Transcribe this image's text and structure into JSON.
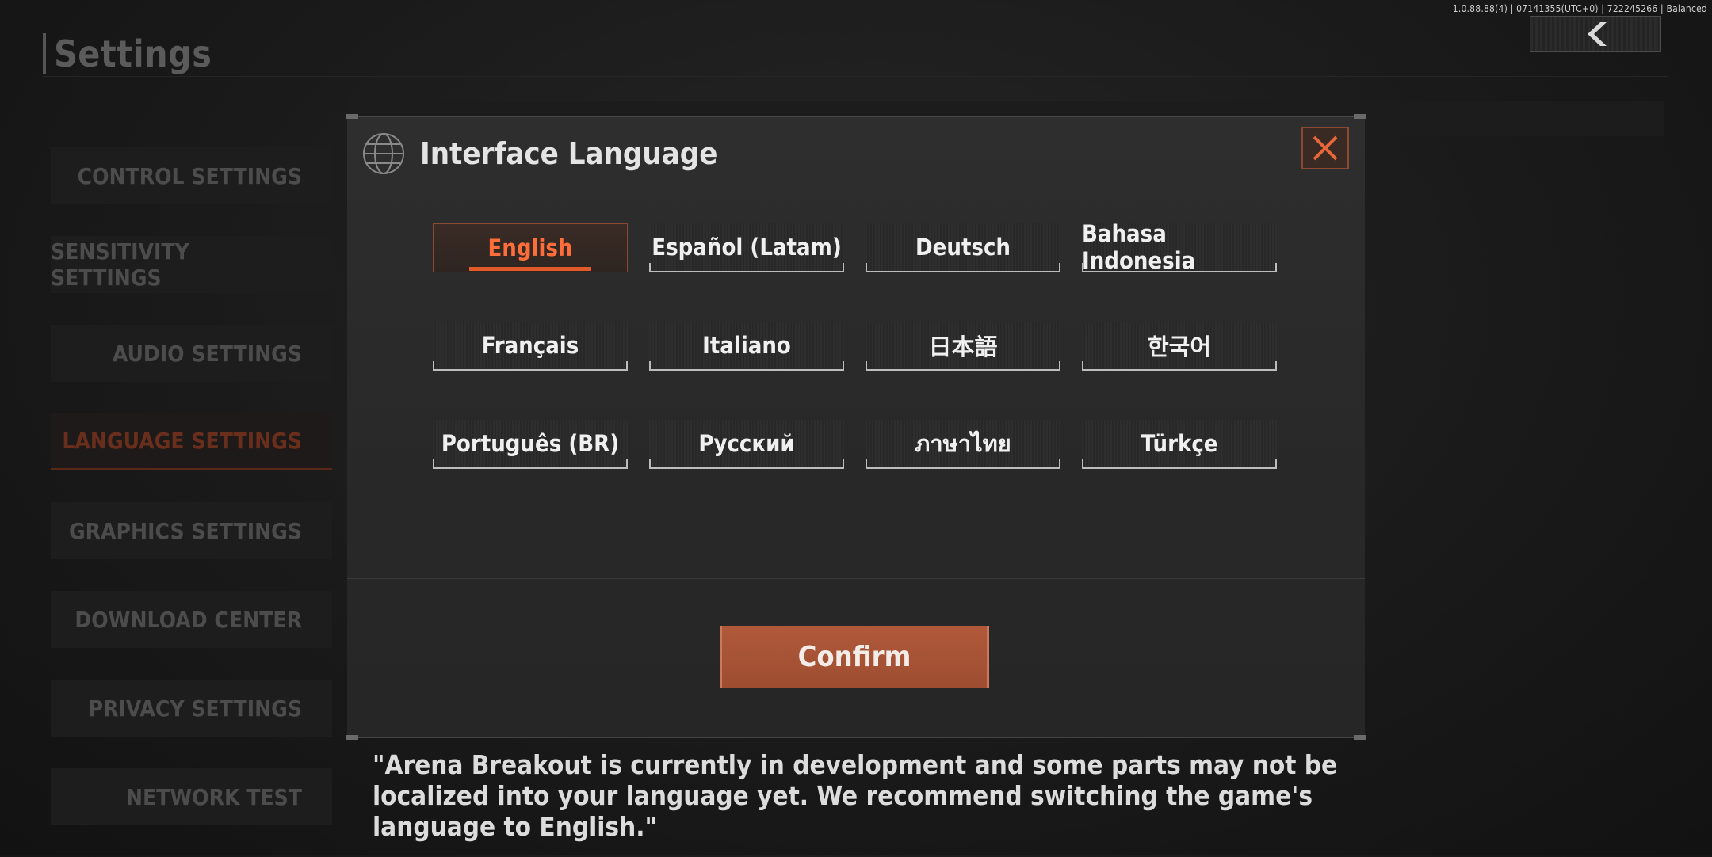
{
  "status_bar": {
    "text": "1.0.88.88(4) | 07141355(UTC+0) | 722245266 | Balanced"
  },
  "page": {
    "title": "Settings"
  },
  "sidebar": {
    "items": [
      {
        "label": "CONTROL SETTINGS"
      },
      {
        "label": "SENSITIVITY SETTINGS"
      },
      {
        "label": "AUDIO SETTINGS"
      },
      {
        "label": "LANGUAGE SETTINGS",
        "active": true
      },
      {
        "label": "GRAPHICS SETTINGS"
      },
      {
        "label": "DOWNLOAD CENTER"
      },
      {
        "label": "PRIVACY SETTINGS"
      },
      {
        "label": "NETWORK TEST"
      }
    ]
  },
  "modal": {
    "title": "Interface Language",
    "languages": [
      "English",
      "Español (Latam)",
      "Deutsch",
      "Bahasa Indonesia",
      "Français",
      "Italiano",
      "日本語",
      "한국어",
      "Português (BR)",
      "Русский",
      "ภาษาไทย",
      "Türkçe"
    ],
    "selected": "English",
    "confirm_label": "Confirm",
    "notice": "\"Arena Breakout is currently in development and some parts may not be localized into your language yet. We recommend switching the game's language to English.\""
  },
  "colors": {
    "accent": "#e05a2a",
    "confirm": "#a8533a",
    "selected_text": "#ff6e3a"
  },
  "icons": {
    "back": "chevron-left-icon",
    "close": "close-icon",
    "globe": "globe-icon"
  }
}
